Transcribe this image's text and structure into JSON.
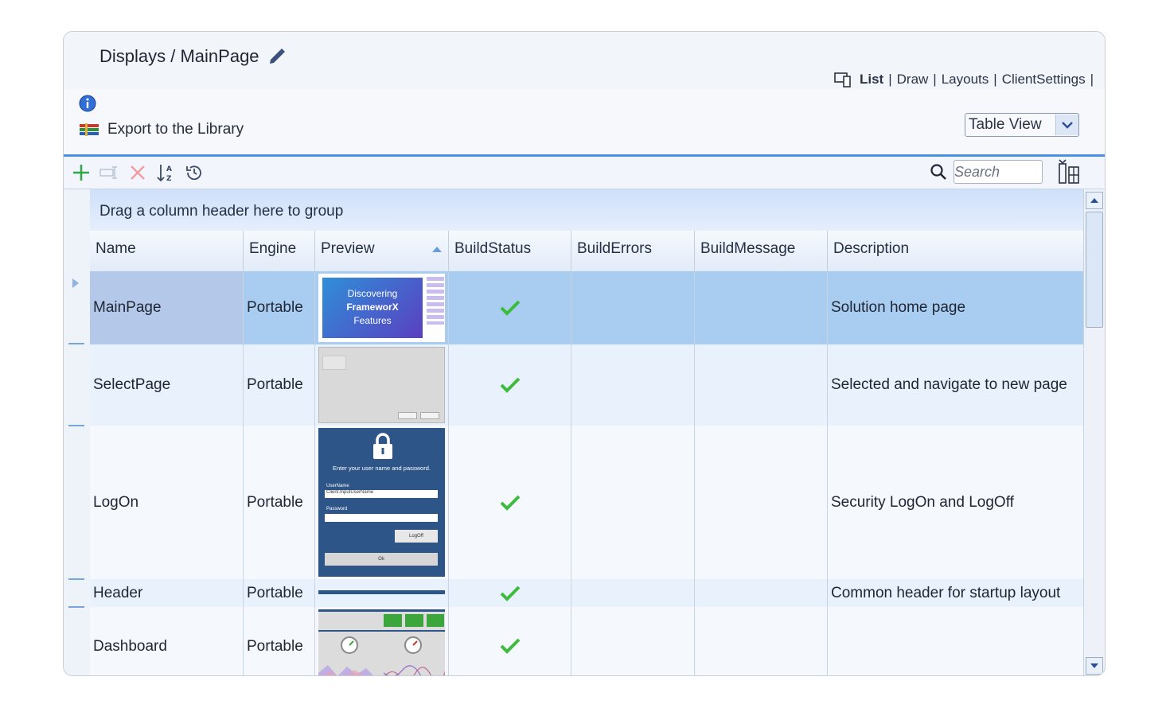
{
  "header": {
    "breadcrumb": "Displays / MainPage",
    "nav": [
      "List",
      "Draw",
      "Layouts",
      "ClientSettings"
    ]
  },
  "subbar": {
    "export_label": "Export to the Library",
    "view_select": "Table View"
  },
  "toolbar": {
    "search_placeholder": "Search"
  },
  "grid": {
    "group_hint": "Drag a column header here to group",
    "columns": [
      "Name",
      "Engine",
      "Preview",
      "BuildStatus",
      "BuildErrors",
      "BuildMessage",
      "Description"
    ],
    "rows": [
      {
        "name": "MainPage",
        "engine": "Portable",
        "build_errors": "",
        "build_message": "",
        "description": "Solution home page"
      },
      {
        "name": "SelectPage",
        "engine": "Portable",
        "build_errors": "",
        "build_message": "",
        "description": "Selected and navigate to new page"
      },
      {
        "name": "LogOn",
        "engine": "Portable",
        "build_errors": "",
        "build_message": "",
        "description": "Security LogOn and LogOff"
      },
      {
        "name": "Header",
        "engine": "Portable",
        "build_errors": "",
        "build_message": "",
        "description": "Common header for startup layout"
      },
      {
        "name": "Dashboard",
        "engine": "Portable",
        "build_errors": "",
        "build_message": "",
        "description": ""
      }
    ]
  },
  "previews": {
    "mainpage": [
      "Discovering",
      "FrameworX",
      "Features"
    ],
    "logon_prompt": "Enter your user name and password.",
    "logon_user_label": "UserName",
    "logon_user_value": "Client.InputUserName",
    "logon_pass_label": "Password",
    "logon_logoff": "LogOff",
    "logon_ok": "Ok"
  },
  "colors": {
    "accent": "#4b90e2",
    "selected_row": "#a8cdf1",
    "check_green": "#3dbb3d"
  }
}
